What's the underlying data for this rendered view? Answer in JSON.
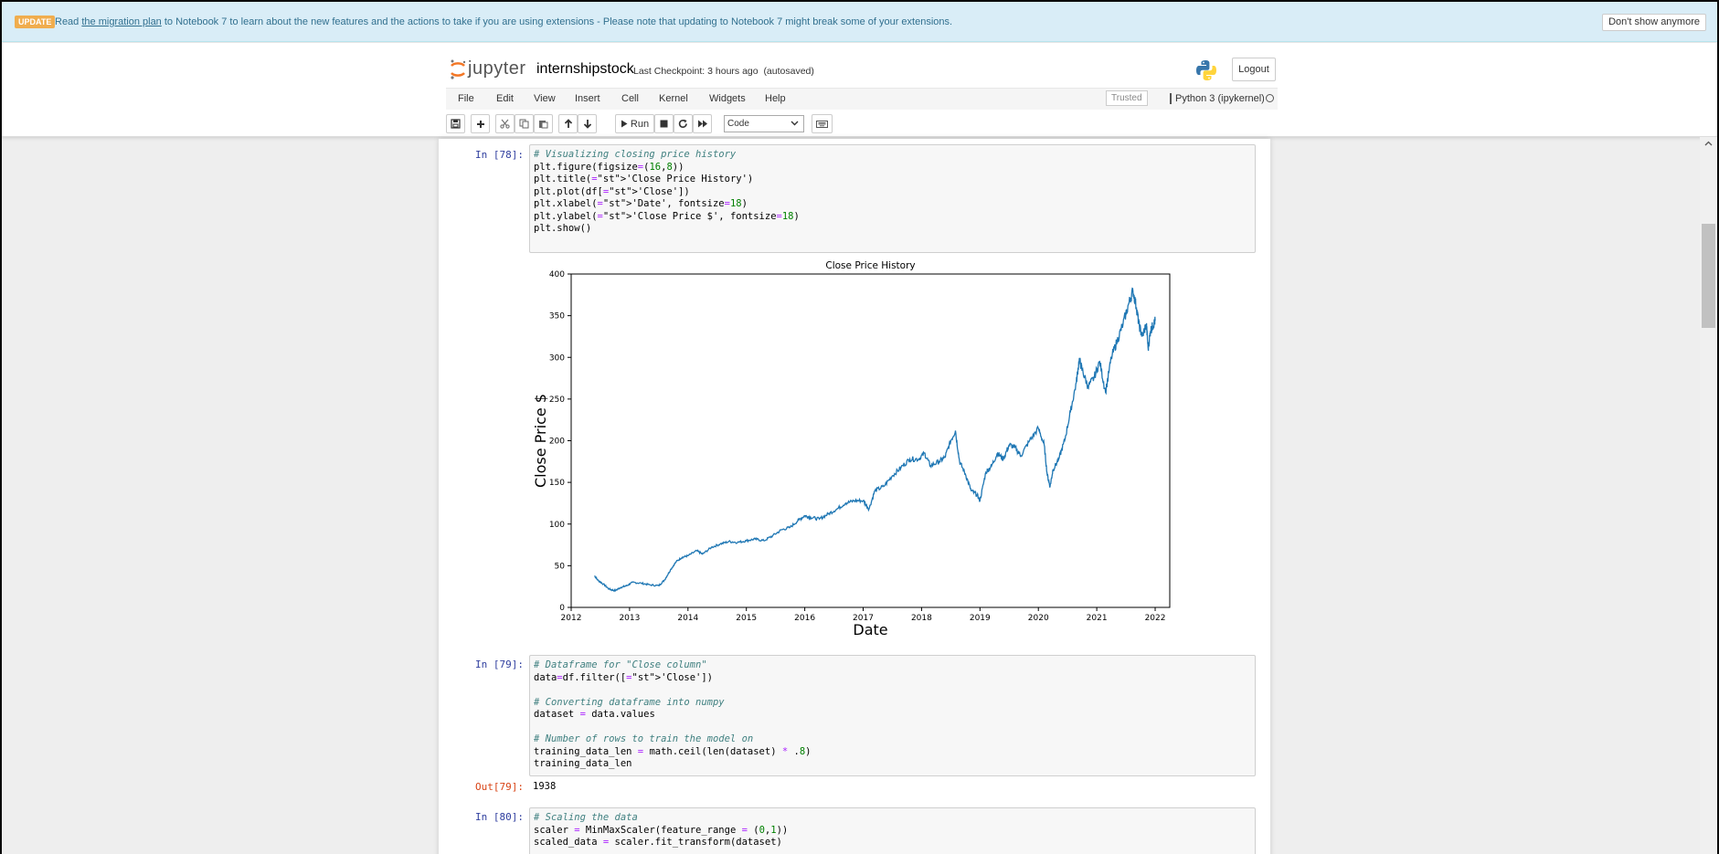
{
  "banner": {
    "badge": "UPDATE",
    "text_before": "Read ",
    "link": "the migration plan",
    "text_after": " to Notebook 7 to learn about the new features and the actions to take if you are using extensions - Please note that updating to Notebook 7 might break some of your extensions.",
    "dismiss": "Don't show anymore"
  },
  "header": {
    "logo_text": "jupyter",
    "notebook_name": "internshipstock",
    "checkpoint": "Last Checkpoint: 3 hours ago",
    "autosaved": "(autosaved)",
    "logout": "Logout"
  },
  "menu": {
    "items": [
      "File",
      "Edit",
      "View",
      "Insert",
      "Cell",
      "Kernel",
      "Widgets",
      "Help"
    ],
    "trusted": "Trusted",
    "kernel": "Python 3 (ipykernel)"
  },
  "toolbar": {
    "run_label": "Run",
    "cell_type": "Code"
  },
  "cells": {
    "c78": {
      "prompt": "In [78]:",
      "lines": [
        "# Visualizing closing price history",
        "plt.figure(figsize=(16,8))",
        "plt.title('Close Price History')",
        "plt.plot(df['Close'])",
        "plt.xlabel('Date', fontsize=18)",
        "plt.ylabel('Close Price $', fontsize=18)",
        "plt.show()"
      ]
    },
    "c79": {
      "prompt": "In [79]:",
      "lines": [
        "# Dataframe for \"Close column\"",
        "data=df.filter(['Close'])",
        "",
        "# Converting dataframe into numpy",
        "dataset = data.values",
        "",
        "# Number of rows to train the model on",
        "training_data_len = math.ceil(len(dataset) * .8)",
        "training_data_len"
      ],
      "out_prompt": "Out[79]:",
      "output": "1938"
    },
    "c80": {
      "prompt": "In [80]:",
      "lines": [
        "# Scaling the data",
        "scaler = MinMaxScaler(feature_range = (0,1))",
        "scaled_data = scaler.fit_transform(dataset)"
      ]
    }
  },
  "chart_data": {
    "type": "line",
    "title": "Close Price History",
    "xlabel": "Date",
    "ylabel": "Close Price $",
    "x_ticks": [
      "2012",
      "2013",
      "2014",
      "2015",
      "2016",
      "2017",
      "2018",
      "2019",
      "2020",
      "2021",
      "2022"
    ],
    "y_ticks": [
      0,
      50,
      100,
      150,
      200,
      250,
      300,
      350,
      400
    ],
    "xlim": [
      2012.0,
      2022.25
    ],
    "ylim": [
      0,
      400
    ],
    "line_color": "#1f77b4",
    "grid": false,
    "series": [
      {
        "x": [
          2012.4,
          2012.45,
          2012.55,
          2012.65,
          2012.75,
          2012.85,
          2012.95,
          2013.05,
          2013.2,
          2013.35,
          2013.5,
          2013.6,
          2013.7,
          2013.8,
          2013.9,
          2014.0,
          2014.15,
          2014.25,
          2014.4,
          2014.55,
          2014.7,
          2014.85,
          2015.0,
          2015.15,
          2015.3,
          2015.45,
          2015.6,
          2015.75,
          2015.9,
          2016.0,
          2016.1,
          2016.25,
          2016.4,
          2016.55,
          2016.7,
          2016.85,
          2017.0,
          2017.1,
          2017.2,
          2017.35,
          2017.5,
          2017.65,
          2017.8,
          2017.95,
          2018.05,
          2018.15,
          2018.3,
          2018.4,
          2018.5,
          2018.58,
          2018.65,
          2018.75,
          2018.85,
          2018.95,
          2019.0,
          2019.1,
          2019.2,
          2019.3,
          2019.4,
          2019.5,
          2019.6,
          2019.7,
          2019.85,
          2020.0,
          2020.1,
          2020.15,
          2020.2,
          2020.25,
          2020.35,
          2020.45,
          2020.55,
          2020.65,
          2020.7,
          2020.75,
          2020.85,
          2020.95,
          2021.05,
          2021.15,
          2021.25,
          2021.35,
          2021.45,
          2021.55,
          2021.62,
          2021.68,
          2021.72,
          2021.78,
          2021.85,
          2021.88,
          2021.92,
          2021.96,
          2022.0
        ],
        "y": [
          38,
          33,
          28,
          22,
          20,
          24,
          26,
          30,
          29,
          27,
          26,
          33,
          45,
          55,
          60,
          62,
          68,
          64,
          72,
          76,
          79,
          78,
          80,
          82,
          80,
          86,
          93,
          96,
          105,
          110,
          108,
          106,
          112,
          118,
          125,
          128,
          128,
          118,
          140,
          145,
          158,
          168,
          178,
          178,
          185,
          170,
          175,
          180,
          200,
          212,
          175,
          160,
          140,
          135,
          128,
          162,
          170,
          185,
          178,
          195,
          192,
          182,
          200,
          215,
          195,
          160,
          145,
          165,
          178,
          200,
          235,
          270,
          298,
          285,
          265,
          275,
          295,
          258,
          300,
          320,
          340,
          365,
          380,
          360,
          340,
          325,
          340,
          310,
          332,
          338,
          344
        ]
      }
    ]
  }
}
